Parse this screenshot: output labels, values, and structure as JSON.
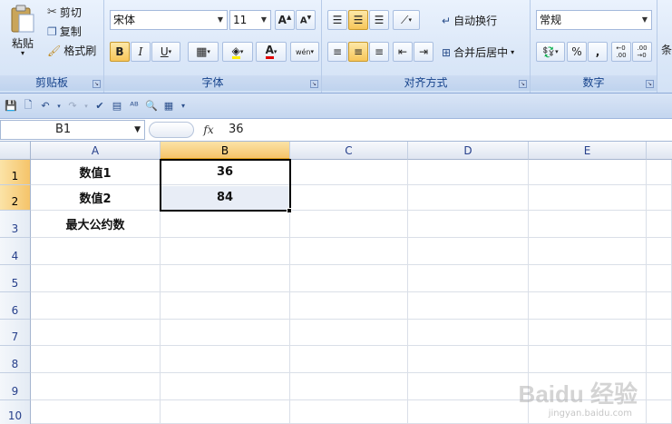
{
  "clipboard": {
    "paste_label": "粘贴",
    "cut_label": "剪切",
    "copy_label": "复制",
    "format_painter_label": "格式刷",
    "group_label": "剪贴板"
  },
  "font": {
    "family": "宋体",
    "size": "11",
    "group_label": "字体",
    "bold": "B",
    "italic": "I",
    "underline": "U",
    "font_color_glyph": "A",
    "phonetic_glyph": "wén"
  },
  "alignment": {
    "wrap_text_label": "自动换行",
    "merge_center_label": "合并后居中",
    "group_label": "对齐方式"
  },
  "number": {
    "format": "常规",
    "percent": "%",
    "comma": ",",
    "group_label": "数字",
    "partial_label": "条"
  },
  "formula_bar": {
    "name_box": "B1",
    "fx": "fx",
    "value": "36"
  },
  "sheet": {
    "columns": [
      "A",
      "B",
      "C",
      "D",
      "E"
    ],
    "rows": [
      "1",
      "2",
      "3",
      "4",
      "5",
      "6",
      "7",
      "8",
      "9",
      "10"
    ],
    "cells": {
      "A1": "数值1",
      "B1": "36",
      "A2": "数值2",
      "B2": "84",
      "A3": "最大公约数"
    }
  },
  "watermark": {
    "brand": "Baidu 经验",
    "sub": "jingyan.baidu.com"
  }
}
